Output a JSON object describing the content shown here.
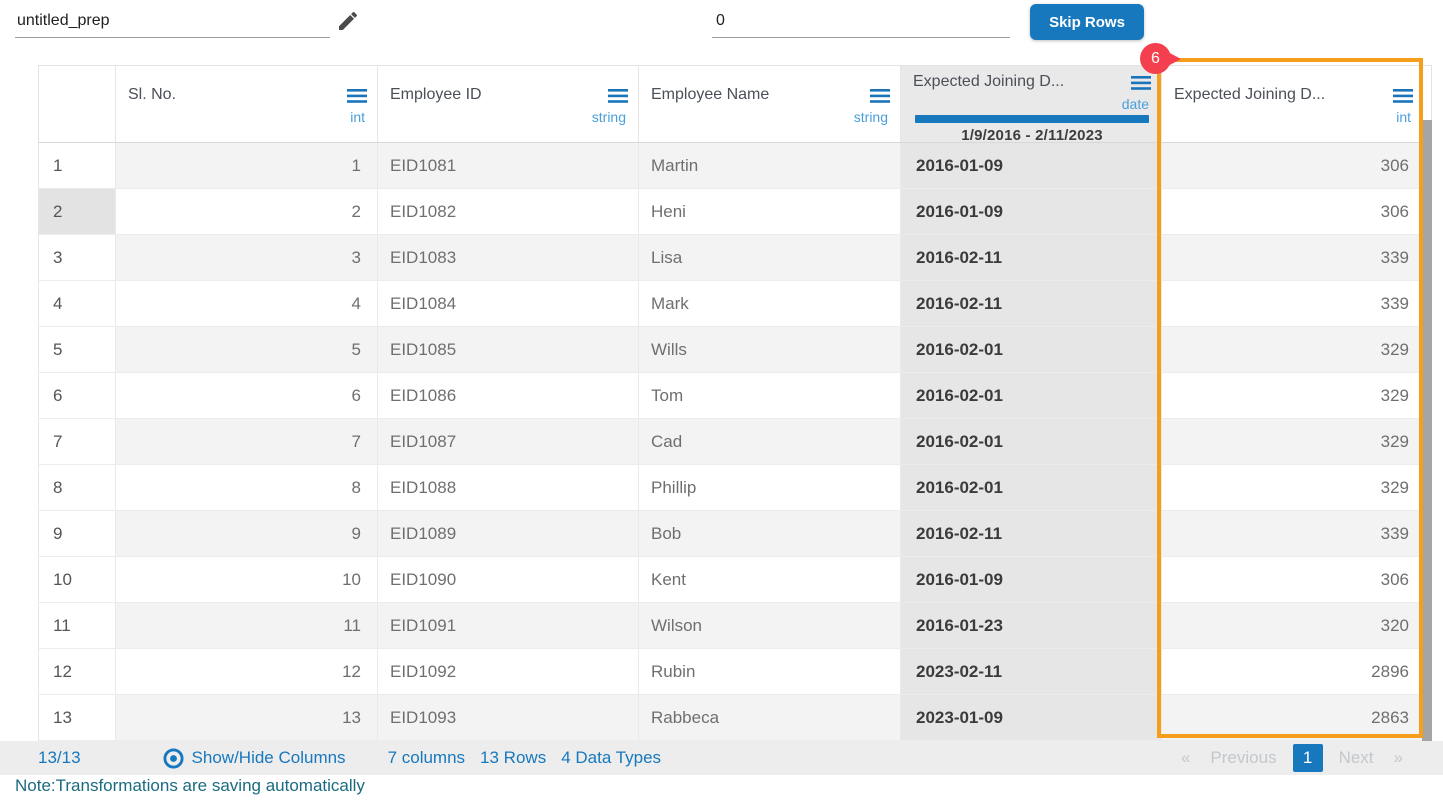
{
  "topbar": {
    "prep_name": "untitled_prep",
    "skip_rows_value": "0",
    "skip_rows_button": "Skip Rows"
  },
  "table": {
    "columns": [
      {
        "title": "Sl. No.",
        "type": "int"
      },
      {
        "title": "Employee ID",
        "type": "string"
      },
      {
        "title": "Employee Name",
        "type": "string"
      },
      {
        "title": "Expected Joining D...",
        "type": "date",
        "range": "1/9/2016 - 2/11/2023"
      },
      {
        "title": "Expected Joining D...",
        "type": "int",
        "badge": "6"
      }
    ],
    "rows": [
      {
        "n": "1",
        "sl": "1",
        "id": "EID1081",
        "name": "Martin",
        "date": "2016-01-09",
        "days": "306"
      },
      {
        "n": "2",
        "sl": "2",
        "id": "EID1082",
        "name": "Heni",
        "date": "2016-01-09",
        "days": "306"
      },
      {
        "n": "3",
        "sl": "3",
        "id": "EID1083",
        "name": "Lisa",
        "date": "2016-02-11",
        "days": "339"
      },
      {
        "n": "4",
        "sl": "4",
        "id": "EID1084",
        "name": "Mark",
        "date": "2016-02-11",
        "days": "339"
      },
      {
        "n": "5",
        "sl": "5",
        "id": "EID1085",
        "name": "Wills",
        "date": "2016-02-01",
        "days": "329"
      },
      {
        "n": "6",
        "sl": "6",
        "id": "EID1086",
        "name": "Tom",
        "date": "2016-02-01",
        "days": "329"
      },
      {
        "n": "7",
        "sl": "7",
        "id": "EID1087",
        "name": "Cad",
        "date": "2016-02-01",
        "days": "329"
      },
      {
        "n": "8",
        "sl": "8",
        "id": "EID1088",
        "name": "Phillip",
        "date": "2016-02-01",
        "days": "329"
      },
      {
        "n": "9",
        "sl": "9",
        "id": "EID1089",
        "name": "Bob",
        "date": "2016-02-11",
        "days": "339"
      },
      {
        "n": "10",
        "sl": "10",
        "id": "EID1090",
        "name": "Kent",
        "date": "2016-01-09",
        "days": "306"
      },
      {
        "n": "11",
        "sl": "11",
        "id": "EID1091",
        "name": "Wilson",
        "date": "2016-01-23",
        "days": "320"
      },
      {
        "n": "12",
        "sl": "12",
        "id": "EID1092",
        "name": "Rubin",
        "date": "2023-02-11",
        "days": "2896"
      },
      {
        "n": "13",
        "sl": "13",
        "id": "EID1093",
        "name": "Rabbeca",
        "date": "2023-01-09",
        "days": "2863"
      }
    ]
  },
  "footer": {
    "row_count": "13/13",
    "show_hide_label": "Show/Hide Columns",
    "stats": [
      "7 columns",
      "13 Rows",
      "4 Data Types"
    ],
    "pagination": {
      "first": "«",
      "previous": "Previous",
      "current_page": "1",
      "next": "Next",
      "last": "»"
    }
  },
  "note": "Note:Transformations are saving automatically",
  "colors": {
    "accent_blue": "#1878be",
    "type_label_blue": "#4aa0dc",
    "highlight_orange": "#f59e1b",
    "badge_red": "#f4404e",
    "date_column_bg": "#e6e6e6",
    "footer_bg": "#ededed",
    "note_text": "#1a6b80"
  }
}
